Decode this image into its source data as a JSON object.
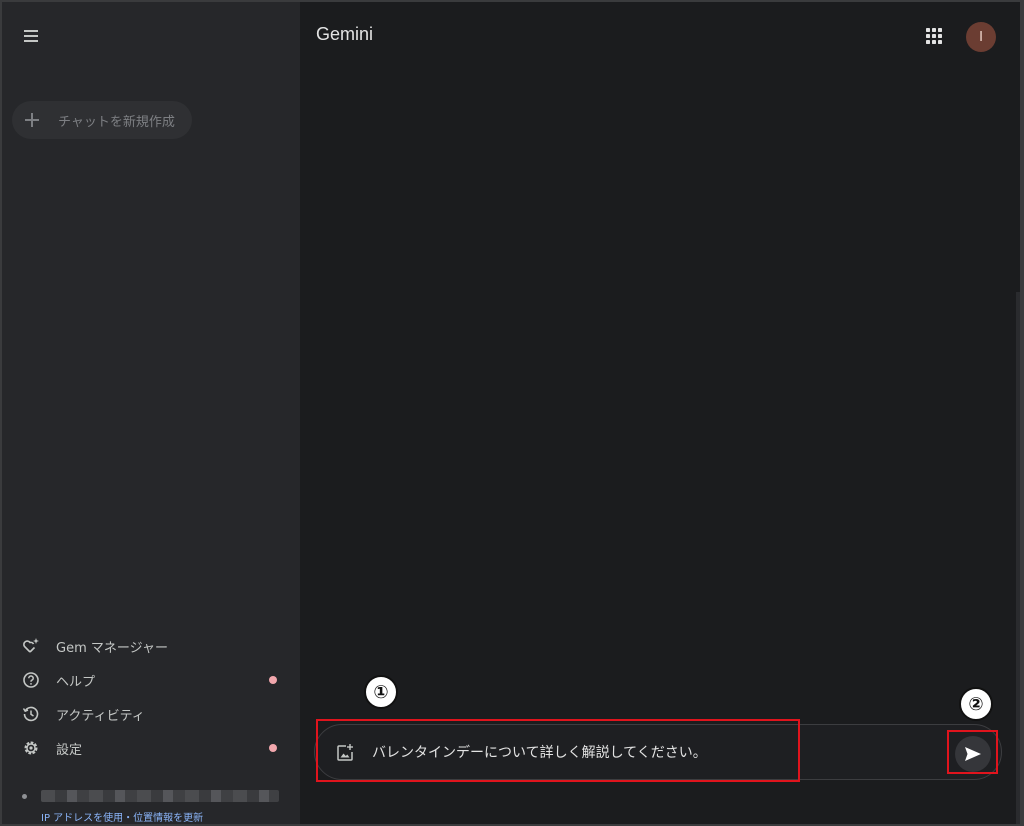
{
  "sidebar": {
    "new_chat_label": "チャットを新規作成",
    "items": [
      {
        "label": "Gem マネージャー",
        "icon": "gem-sparkle-icon",
        "dot": false
      },
      {
        "label": "ヘルプ",
        "icon": "help-circle-icon",
        "dot": true
      },
      {
        "label": "アクティビティ",
        "icon": "history-icon",
        "dot": false
      },
      {
        "label": "設定",
        "icon": "gear-icon",
        "dot": true
      }
    ],
    "location_link": "IP アドレスを使用・位置情報を更新"
  },
  "header": {
    "brand": "Gemini",
    "avatar_initial": "I"
  },
  "composer": {
    "prompt_value": "バレンタインデーについて詳しく解説してください。"
  },
  "annotations": {
    "step1": "①",
    "step2": "②"
  },
  "colors": {
    "background": "#1b1c1e",
    "sidebar": "#26272a",
    "annotation": "#e0141d",
    "notification_dot": "#f2a7ad",
    "link": "#8ab4f8"
  }
}
